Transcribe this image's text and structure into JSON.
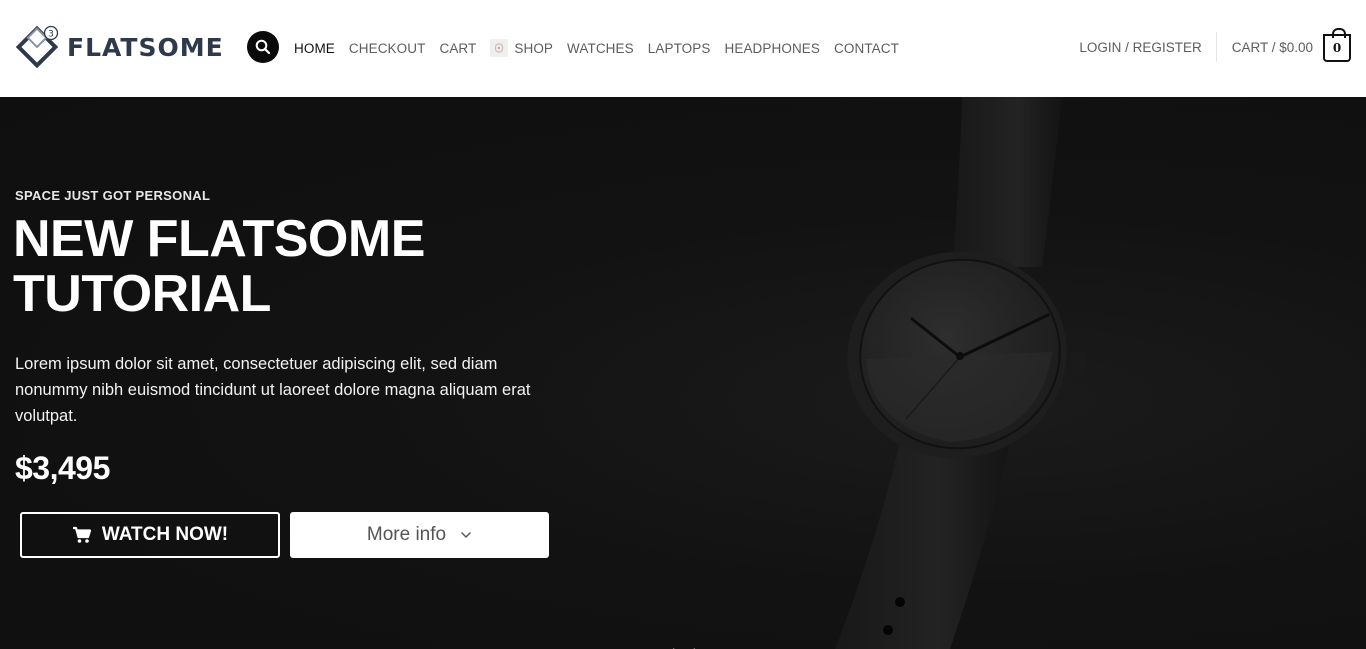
{
  "brand": {
    "name": "FLATSOME",
    "badge": "3"
  },
  "nav": {
    "items": [
      "HOME",
      "CHECKOUT",
      "CART",
      "SHOP",
      "WATCHES",
      "LAPTOPS",
      "HEADPHONES",
      "CONTACT"
    ]
  },
  "account": {
    "login_label": "LOGIN / REGISTER"
  },
  "cart": {
    "label": "CART / $0.00",
    "count": "0"
  },
  "hero": {
    "eyebrow": "SPACE JUST GOT PERSONAL",
    "title_line1": "NEW FLATSOME",
    "title_line2": "TUTORIAL",
    "text": "Lorem ipsum dolor sit amet, consectetuer adipiscing elit, sed diam nonummy nibh euismod tincidunt ut laoreet dolore magna aliquam erat volutpat.",
    "price": "$3,495",
    "primary_button": "WATCH NOW!",
    "secondary_button": "More info"
  },
  "icons": {
    "search": "search-icon",
    "cart": "cart-icon",
    "shop": "shop-icon",
    "button_cart": "shopping-cart-icon",
    "chevron": "chevron-down-icon",
    "scroll": "scroll-down-icon"
  },
  "colors": {
    "header_bg": "#ffffff",
    "hero_bg": "#111111",
    "logo_text": "#2e3a4b",
    "nav_text": "#5d5d5d",
    "button_text": "#ffffff"
  }
}
